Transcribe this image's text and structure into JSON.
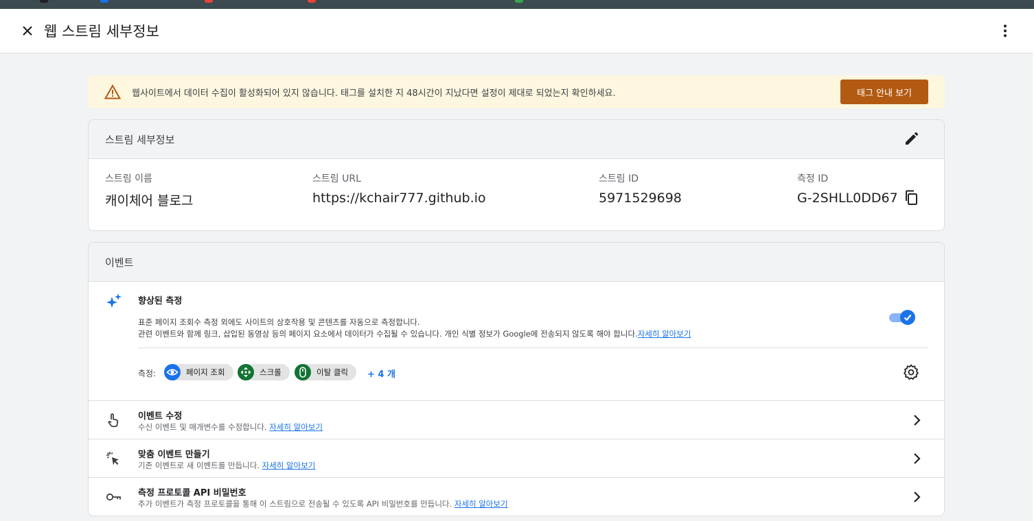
{
  "header": {
    "title": "웹 스트림 세부정보"
  },
  "warning": {
    "text": "웹사이트에서 데이터 수집이 활성화되어 있지 않습니다. 태그를 설치한 지 48시간이 지났다면 설정이 제대로 되었는지 확인하세요.",
    "button": "태그 안내 보기",
    "accent": "#b25a12"
  },
  "stream": {
    "section_title": "스트림 세부정보",
    "name_label": "스트림 이름",
    "name": "캐이체어 블로그",
    "url_label": "스트림 URL",
    "url": "https://kchair777.github.io",
    "id_label": "스트림 ID",
    "id": "5971529698",
    "measurement_label": "측정 ID",
    "measurement_id": "G-2SHLL0DD67"
  },
  "events": {
    "section_title": "이벤트",
    "enhanced": {
      "title": "향상된 측정",
      "desc_line1": "표준 페이지 조회수 측정 외에도 사이트의 상호작용 및 콘텐츠를 자동으로 측정합니다.",
      "desc_line2": "관련 이벤트와 함께 링크, 삽입된 동영상 등의 페이지 요소에서 데이터가 수집될 수 있습니다. 개인 식별 정보가 Google에 전송되지 않도록 해야 합니다.",
      "learn_more": "자세히 알아보기",
      "measuring_label": "측정:",
      "chips": [
        "페이지 조회",
        "스크롤",
        "이탈 클릭"
      ],
      "more": "+ 4 개",
      "enabled": true
    },
    "rows": [
      {
        "title": "이벤트 수정",
        "desc": "수신 이벤트 및 매개변수를 수정합니다.",
        "link": "자세히 알아보기",
        "icon": "touch-icon"
      },
      {
        "title": "맞춤 이벤트 만들기",
        "desc": "기존 이벤트로 새 이벤트를 만듭니다.",
        "link": "자세히 알아보기",
        "icon": "click-sparkle-icon"
      },
      {
        "title": "측정 프로토콜 API 비밀번호",
        "desc": "추가 이벤트가 측정 프로토콜을 통해 이 스트림으로 전송될 수 있도록 API 비밀번호를 만듭니다.",
        "link": "자세히 알아보기",
        "icon": "key-icon"
      }
    ]
  }
}
